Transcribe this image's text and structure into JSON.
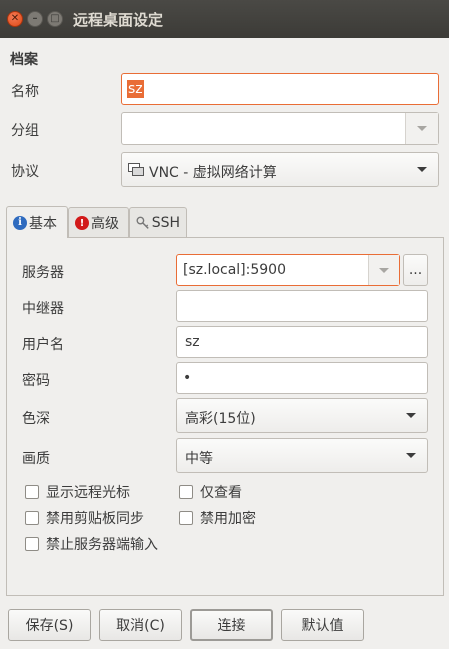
{
  "window": {
    "title": "远程桌面设定"
  },
  "profile_section": {
    "heading": "档案"
  },
  "name_field": {
    "label": "名称",
    "value": "sz"
  },
  "group_field": {
    "label": "分组",
    "value": ""
  },
  "protocol_field": {
    "label": "协议",
    "value": "VNC - 虚拟网络计算"
  },
  "tabs": [
    {
      "label": "基本",
      "icon": "info-icon"
    },
    {
      "label": "高级",
      "icon": "warning-icon"
    },
    {
      "label": "SSH",
      "icon": "key-icon"
    }
  ],
  "basic": {
    "server": {
      "label": "服务器",
      "value": "[sz.local]:5900",
      "browse_label": "..."
    },
    "repeater": {
      "label": "中继器",
      "value": ""
    },
    "username": {
      "label": "用户名",
      "value": "sz"
    },
    "password": {
      "label": "密码",
      "value": "•"
    },
    "color_depth": {
      "label": "色深",
      "value": "高彩(15位)"
    },
    "quality": {
      "label": "画质",
      "value": "中等"
    },
    "checkboxes": {
      "show_remote_cursor": "显示远程光标",
      "view_only": "仅查看",
      "disable_clipboard_sync": "禁用剪贴板同步",
      "disable_encryption": "禁用加密",
      "disable_server_input": "禁止服务器端输入"
    }
  },
  "buttons": {
    "save": "保存(S)",
    "cancel": "取消(C)",
    "connect": "连接",
    "default": "默认值"
  },
  "colors": {
    "name_highlight": "#e96d36",
    "accent": "#e96d36"
  }
}
